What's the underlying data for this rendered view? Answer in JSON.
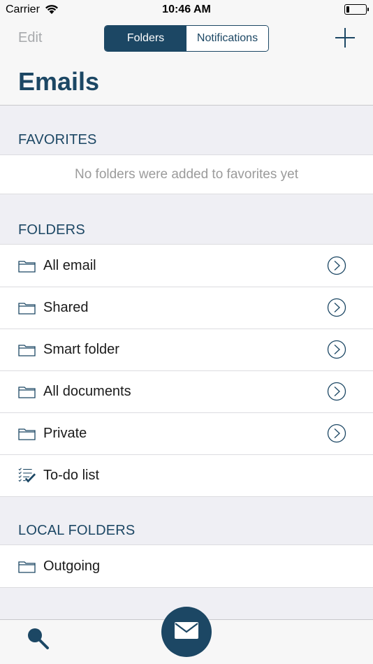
{
  "status_bar": {
    "carrier": "Carrier",
    "time": "10:46 AM",
    "wifi_icon": "wifi-icon",
    "battery_icon": "battery-icon",
    "battery_level": 0.1
  },
  "nav": {
    "edit_label": "Edit",
    "segments": [
      {
        "label": "Folders",
        "active": true
      },
      {
        "label": "Notifications",
        "active": false
      }
    ],
    "add_icon": "plus-icon",
    "title": "Emails"
  },
  "favorites": {
    "header": "FAVORITES",
    "empty_text": "No folders were added to favorites yet"
  },
  "folders": {
    "header": "FOLDERS",
    "items": [
      {
        "label": "All email",
        "icon": "folder-icon",
        "has_chevron": true
      },
      {
        "label": "Shared",
        "icon": "folder-icon",
        "has_chevron": true
      },
      {
        "label": "Smart folder",
        "icon": "folder-icon",
        "has_chevron": true
      },
      {
        "label": "All documents",
        "icon": "folder-icon",
        "has_chevron": true
      },
      {
        "label": "Private",
        "icon": "folder-icon",
        "has_chevron": true
      },
      {
        "label": "To-do list",
        "icon": "checklist-icon",
        "has_chevron": false
      }
    ]
  },
  "local_folders": {
    "header": "LOCAL FOLDERS",
    "items": [
      {
        "label": "Outgoing",
        "icon": "folder-icon"
      }
    ]
  },
  "tabbar": {
    "search_icon": "search-icon",
    "compose_icon": "mail-icon"
  },
  "colors": {
    "accent": "#1c4764",
    "background": "#efeff4",
    "muted_text": "#9b9b9b"
  }
}
